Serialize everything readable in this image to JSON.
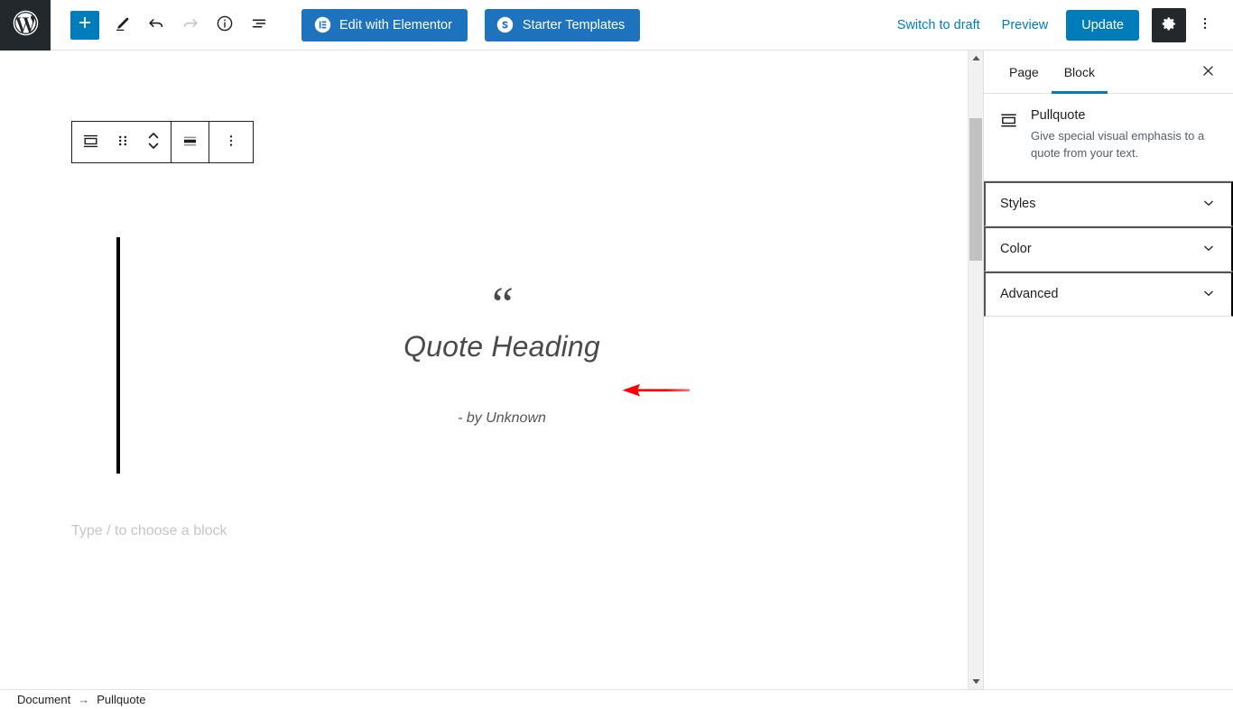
{
  "topbar": {
    "logo_icon": "wordpress-logo-icon",
    "add_block_icon": "plus-icon",
    "tools": [
      {
        "name": "edit-tool",
        "icon": "pencil-icon",
        "disabled": false
      },
      {
        "name": "undo",
        "icon": "undo-arrow-icon",
        "disabled": false
      },
      {
        "name": "redo",
        "icon": "redo-arrow-icon",
        "disabled": true
      },
      {
        "name": "details",
        "icon": "info-circle-icon",
        "disabled": false
      },
      {
        "name": "list-view",
        "icon": "list-view-icon",
        "disabled": false
      }
    ],
    "elementor_label": "Edit with Elementor",
    "elementor_icon": "elementor-logo-icon",
    "starter_templates_label": "Starter Templates",
    "starter_templates_icon": "starter-templates-logo-icon",
    "switch_to_draft_label": "Switch to draft",
    "preview_label": "Preview",
    "update_label": "Update",
    "settings_icon": "gear-icon",
    "more_icon": "kebab-menu-icon",
    "accent_blue": "#007cba",
    "plugin_blue": "#1e73be",
    "dark": "#23282d"
  },
  "block_toolbar": {
    "items": [
      {
        "name": "block-type-pullquote",
        "icon": "pullquote-icon"
      },
      {
        "name": "drag-handle",
        "icon": "drag-dots-icon"
      },
      {
        "name": "move-block",
        "icon": "up-down-chevrons-icon"
      },
      {
        "name": "change-alignment",
        "icon": "align-center-icon"
      },
      {
        "name": "block-options",
        "icon": "kebab-menu-icon"
      }
    ]
  },
  "canvas": {
    "pullquote": {
      "quote_mark": "“",
      "heading": "Quote Heading",
      "citation": "- by Unknown",
      "border_color": "#000000"
    },
    "empty_block_placeholder": "Type / to choose a block",
    "annotation": {
      "name": "red-arrow-annotation",
      "color": "#ff0000",
      "direction": "left"
    }
  },
  "scrollbar": {
    "up_icon": "scroll-up-arrow-icon",
    "down_icon": "scroll-down-arrow-icon"
  },
  "sidebar": {
    "tabs": [
      {
        "label": "Page",
        "active": false
      },
      {
        "label": "Block",
        "active": true
      }
    ],
    "close_icon": "close-icon",
    "block_card": {
      "icon": "pullquote-icon",
      "title": "Pullquote",
      "description": "Give special visual emphasis to a quote from your text."
    },
    "panels": [
      {
        "label": "Styles",
        "icon": "chevron-down-icon"
      },
      {
        "label": "Color",
        "icon": "chevron-down-icon"
      },
      {
        "label": "Advanced",
        "icon": "chevron-down-icon"
      }
    ]
  },
  "breadcrumb": {
    "items": [
      "Document",
      "Pullquote"
    ],
    "separator": "→"
  }
}
